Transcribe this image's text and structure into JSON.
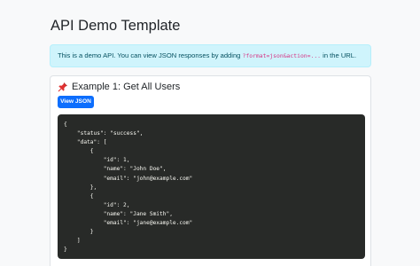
{
  "page": {
    "title": "API Demo Template"
  },
  "alert": {
    "text_before": "This is a demo API. You can view JSON responses by adding ",
    "code": "?format=json&action=...",
    "text_after": " in the URL."
  },
  "example": {
    "icon": "pushpin-icon",
    "title": "Example 1: Get All Users",
    "button_label": "View JSON",
    "json_output": "{\n    \"status\": \"success\",\n    \"data\": [\n        {\n            \"id\": 1,\n            \"name\": \"John Doe\",\n            \"email\": \"john@example.com\"\n        },\n        {\n            \"id\": 2,\n            \"name\": \"Jane Smith\",\n            \"email\": \"jane@example.com\"\n        }\n    ]\n}"
  },
  "colors": {
    "alert_bg": "#cff4fc",
    "button_bg": "#0d6efd",
    "code_bg": "#282a28"
  }
}
